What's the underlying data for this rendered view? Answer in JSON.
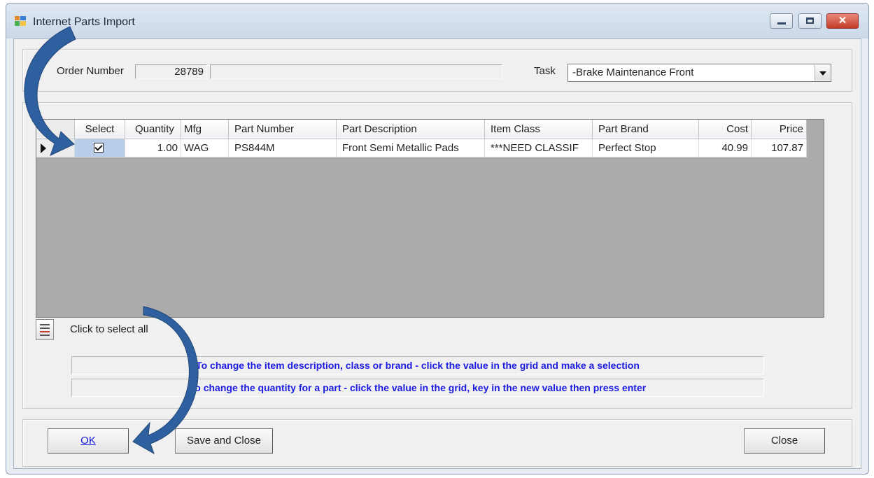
{
  "window": {
    "title": "Internet Parts Import"
  },
  "header": {
    "order_number_label": "Order Number",
    "order_number_value": "28789",
    "order_extra_value": "",
    "task_label": "Task",
    "task_value": "-Brake Maintenance Front"
  },
  "grid": {
    "columns": [
      "Select",
      "Quantity",
      "Mfg",
      "Part Number",
      "Part Description",
      "Item Class",
      "Part Brand",
      "Cost",
      "Price"
    ],
    "rows": [
      {
        "selected": true,
        "quantity": "1.00",
        "mfg": "WAG",
        "part_number": "PS844M",
        "part_description": "Front Semi Metallic Pads",
        "item_class": "***NEED CLASSIF",
        "part_brand": "Perfect Stop",
        "cost": "40.99",
        "price": "107.87"
      }
    ]
  },
  "select_all_label": "Click to select all",
  "info_lines": [
    "To change the item description, class or brand - click the value in the grid and make a selection",
    "To change the quantity for a part - click the value in the grid, key in the new value then press enter"
  ],
  "buttons": {
    "ok": "OK",
    "save_close": "Save and Close",
    "close": "Close"
  },
  "colors": {
    "info_text": "#1c1ce0",
    "callout_arrow": "#2e5f9e",
    "grid_background": "#ababab"
  }
}
